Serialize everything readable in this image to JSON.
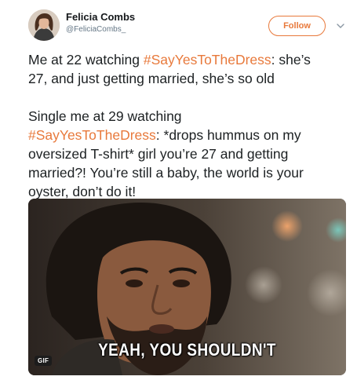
{
  "author": {
    "name": "Felicia Combs",
    "handle": "@FeliciaCombs_"
  },
  "follow_button": {
    "label": "Follow"
  },
  "icons": {
    "avatar": "avatar-photo",
    "caret": "chevron-down-icon"
  },
  "tweet": {
    "p1_line1_prefix": "Me at 22 watching ",
    "p1_line1_hashtag": "#SayYesToTheDress",
    "p1_line1_suffix": ": she’s",
    "p1_line2": "27, and just getting married, she’s so old",
    "p2_line1": "Single me at 29 watching",
    "p2_line2_hashtag": "#SayYesToTheDress",
    "p2_line2_suffix": ": *drops hummus on my",
    "p2_line3": "oversized T-shirt* girl you’re 27 and getting",
    "p2_line4": "married?! You’re still a baby, the world is your",
    "p2_line5": "oyster, don’t do it!"
  },
  "media": {
    "caption": "YEAH, YOU SHOULDN'T",
    "badge": "GIF"
  },
  "colors": {
    "accent": "#e8793b",
    "text": "#1c2022",
    "muted": "#657786"
  }
}
